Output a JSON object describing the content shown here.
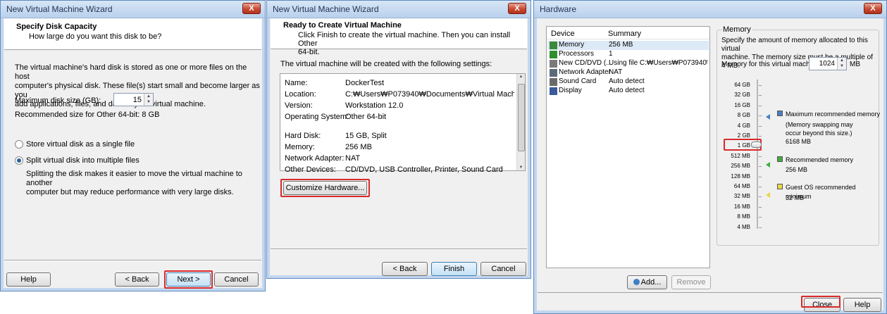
{
  "wizard1": {
    "title": "New Virtual Machine Wizard",
    "close": "X",
    "heading": "Specify Disk Capacity",
    "subheading": "How large do you want this disk to be?",
    "desc": [
      "The virtual machine's hard disk is stored as one or more files on the host",
      "computer's physical disk. These file(s) start small and become larger as you",
      "add applications, files, and data to your virtual machine."
    ],
    "max_size_label": "Maximum disk size (GB):",
    "max_size_value": "15",
    "recommended": "Recommended size for Other 64-bit: 8 GB",
    "opt_single": "Store virtual disk as a single file",
    "opt_split": "Split virtual disk into multiple files",
    "split_desc": [
      "Splitting the disk makes it easier to move the virtual machine to another",
      "computer but may reduce performance with very large disks."
    ],
    "help": "Help",
    "back": "< Back",
    "next": "Next >",
    "cancel": "Cancel"
  },
  "wizard2": {
    "title": "New Virtual Machine Wizard",
    "close": "X",
    "heading": "Ready to Create Virtual Machine",
    "subheading": [
      "Click Finish to create the virtual machine. Then you can install Other",
      "64-bit."
    ],
    "intro": "The virtual machine will be created with the following settings:",
    "settings": [
      {
        "k": "Name:",
        "v": "DockerTest"
      },
      {
        "k": "Location:",
        "v": "C:₩Users₩P073940₩Documents₩Virtual Machines..."
      },
      {
        "k": "Version:",
        "v": "Workstation 12.0"
      },
      {
        "k": "Operating System:",
        "v": "Other 64-bit"
      },
      {
        "k": "Hard Disk:",
        "v": "15 GB, Split"
      },
      {
        "k": "Memory:",
        "v": "256 MB"
      },
      {
        "k": "Network Adapter:",
        "v": "NAT"
      },
      {
        "k": "Other Devices:",
        "v": "CD/DVD, USB Controller, Printer, Sound Card"
      }
    ],
    "customize": "Customize Hardware...",
    "back": "< Back",
    "finish": "Finish",
    "cancel": "Cancel"
  },
  "hardware": {
    "title": "Hardware",
    "close": "X",
    "col_device": "Device",
    "col_summary": "Summary",
    "devices": [
      {
        "name": "Memory",
        "summary": "256 MB"
      },
      {
        "name": "Processors",
        "summary": "1"
      },
      {
        "name": "New CD/DVD (...",
        "summary": "Using file C:₩Users₩P073940₩..."
      },
      {
        "name": "Network Adapter",
        "summary": "NAT"
      },
      {
        "name": "Sound Card",
        "summary": "Auto detect"
      },
      {
        "name": "Display",
        "summary": "Auto detect"
      }
    ],
    "add": "Add...",
    "remove": "Remove",
    "memory_group": "Memory",
    "memory_desc": [
      "Specify the amount of memory allocated to this virtual",
      "machine. The memory size must be a multiple of 4 MB."
    ],
    "memory_for_label": "Memory for this virtual machine:",
    "memory_value": "1024",
    "memory_unit": "MB",
    "scale": [
      "64 GB",
      "32 GB",
      "16 GB",
      "8 GB",
      "4 GB",
      "2 GB",
      "1 GB",
      "512 MB",
      "256 MB",
      "128 MB",
      "64 MB",
      "32 MB",
      "16 MB",
      "8 MB",
      "4 MB"
    ],
    "max_rec_label": "Maximum recommended memory",
    "max_rec_note": [
      "(Memory swapping may",
      "occur beyond this size.)"
    ],
    "max_rec_value": "6168 MB",
    "rec_label": "Recommended memory",
    "rec_value": "256 MB",
    "guest_label": "Guest OS recommended minimum",
    "guest_value": "32 MB",
    "close_btn": "Close",
    "help": "Help",
    "colors": {
      "max": "#4a7fc1",
      "rec": "#3fae3f",
      "guest": "#e8d84a"
    }
  }
}
